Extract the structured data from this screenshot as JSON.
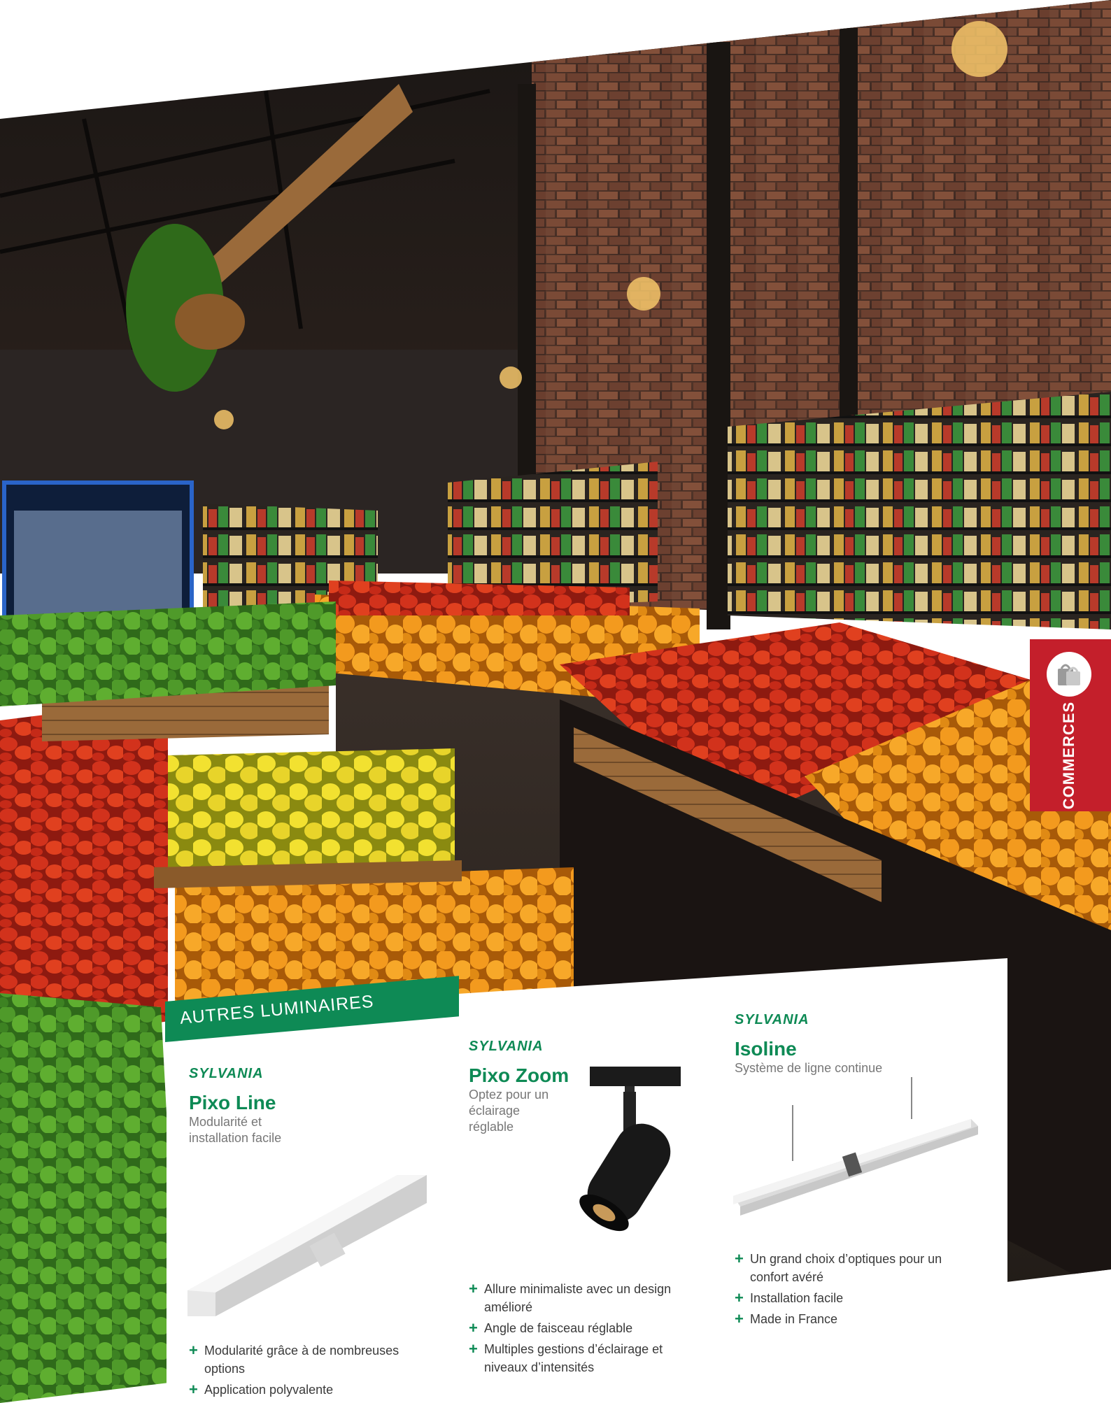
{
  "side_tab": {
    "label": "COMMERCES",
    "icon": "shopping-bags-icon",
    "color": "#c41f2b"
  },
  "section": {
    "title": "AUTRES LUMINAIRES",
    "color": "#0e8a55"
  },
  "products": [
    {
      "brand": "SYLVANIA",
      "name": "Pixo Line",
      "tagline": "Modularité et installation facile",
      "features": [
        "Modularité grâce à de nombreuses options",
        "Application polyvalente"
      ]
    },
    {
      "brand": "SYLVANIA",
      "name": "Pixo Zoom",
      "tagline": "Optez pour un éclairage réglable",
      "features": [
        "Allure minimaliste avec un design amélioré",
        "Angle de faisceau réglable",
        "Multiples gestions d’éclairage et niveaux d’intensités"
      ]
    },
    {
      "brand": "SYLVANIA",
      "name": "Isoline",
      "tagline": "Système de ligne continue",
      "features": [
        "Un grand choix d’optiques pour un confort avéré",
        "Installation facile",
        "Made in France"
      ]
    }
  ]
}
